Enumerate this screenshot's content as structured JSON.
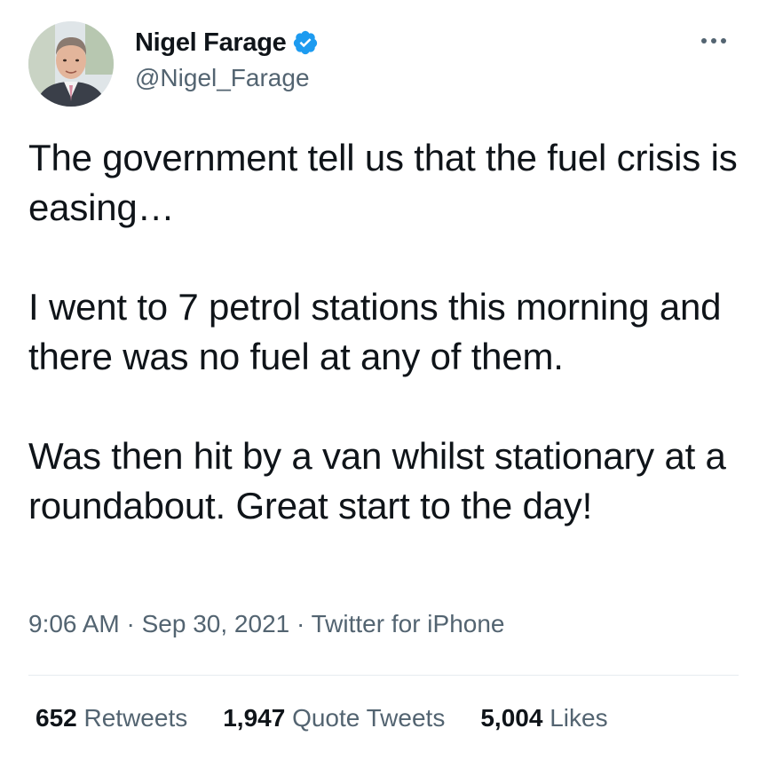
{
  "author": {
    "display_name": "Nigel Farage",
    "handle": "@Nigel_Farage",
    "verified_icon": "verified-badge-icon",
    "verified_color": "#1d9bf0"
  },
  "more_icon": "more-options-icon",
  "tweet": {
    "paragraphs": [
      "The government tell us that the fuel crisis is easing…",
      "I went to 7 petrol stations this morning and there was no fuel at any of them.",
      "Was then hit by a van whilst stationary at a roundabout. Great start to the day!"
    ],
    "time": "9:06 AM",
    "separator": "·",
    "date": "Sep 30, 2021",
    "source": "Twitter for iPhone"
  },
  "stats": {
    "retweets": {
      "count": "652",
      "label": "Retweets"
    },
    "quote_tweets": {
      "count": "1,947",
      "label": "Quote Tweets"
    },
    "likes": {
      "count": "5,004",
      "label": "Likes"
    }
  },
  "colors": {
    "text": "#0f1419",
    "secondary": "#536471",
    "divider": "#e6ecf0"
  }
}
